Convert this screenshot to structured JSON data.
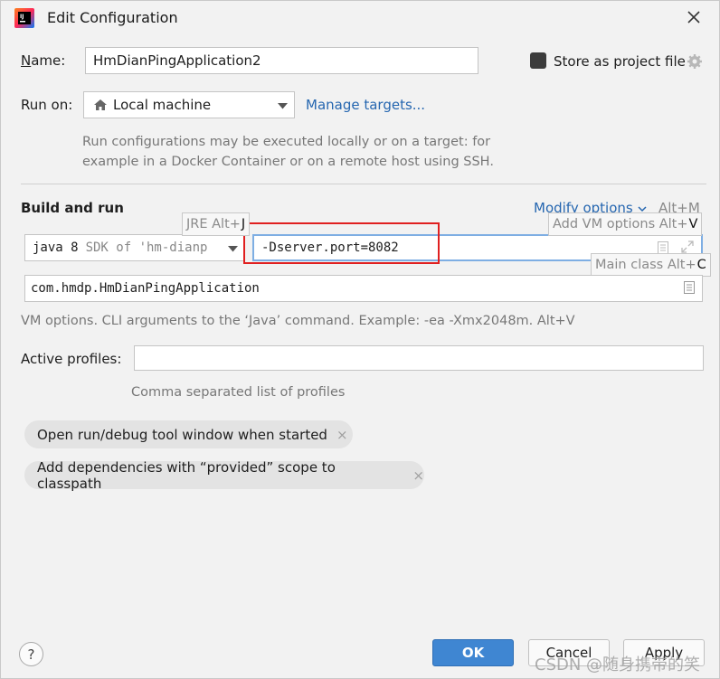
{
  "window": {
    "title": "Edit Configuration",
    "app_icon": "intellij-idea-icon",
    "close_icon": "close-icon"
  },
  "name": {
    "label": "Name:",
    "value": "HmDianPingApplication2"
  },
  "store_as_project_file": {
    "label": "Store as project file",
    "checked": false,
    "icon": "gear-icon"
  },
  "run_on": {
    "label": "Run on:",
    "selected": "Local machine",
    "icon": "home-icon",
    "manage_targets_link": "Manage targets...",
    "description_line1": "Run configurations may be executed locally or on a target: for",
    "description_line2": "example in a Docker Container or on a remote host using SSH."
  },
  "build_and_run": {
    "heading": "Build and run",
    "modify_options": "Modify options",
    "modify_options_shortcut": "Alt+M",
    "jre_tooltip": "JRE Alt+",
    "jre_tooltip_key": "J",
    "jre_value": "java 8",
    "jre_hint": "SDK of 'hm-dianp",
    "vm_options_value": "-Dserver.port=8082",
    "vm_tooltip": "Add VM options Alt+",
    "vm_tooltip_key": "V",
    "main_class_tooltip": "Main class Alt+",
    "main_class_tooltip_key": "C",
    "main_class_value": "com.hmdp.HmDianPingApplication",
    "vm_help": "VM options. CLI arguments to the ‘Java’ command. Example: -ea -Xmx2048m. Alt+V"
  },
  "active_profiles": {
    "label": "Active profiles:",
    "value": "",
    "hint": "Comma separated list of profiles"
  },
  "chips": [
    {
      "label": "Open run/debug tool window when started",
      "remove": "×"
    },
    {
      "label": "Add dependencies with “provided” scope to classpath",
      "remove": "×"
    }
  ],
  "footer": {
    "help": "?",
    "ok": "OK",
    "cancel": "Cancel",
    "apply": "Apply",
    "watermark": "CSDN @随身携带的笑"
  },
  "colors": {
    "accent": "#3f86d2",
    "link": "#2566b0",
    "highlight_box": "#e02020"
  }
}
